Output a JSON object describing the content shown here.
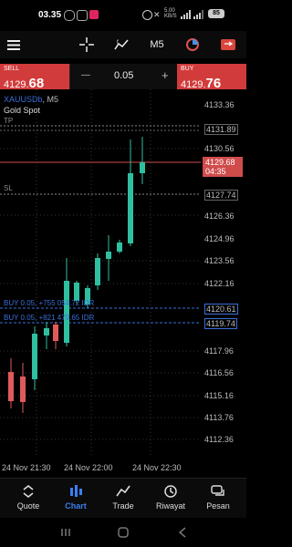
{
  "status": {
    "time": "03.35",
    "speed": "5.00\nKB/S",
    "battery": "85"
  },
  "toolbar": {
    "timeframe": "M5",
    "icons": [
      "menu-icon",
      "crosshair-icon",
      "indicator-icon",
      "timeframe-label",
      "clock-icon",
      "trade-icon"
    ]
  },
  "trade": {
    "sell_label": "SELL",
    "sell_price_small": "4129.",
    "sell_price_big": "68",
    "buy_label": "BUY",
    "buy_price_small": "4129.",
    "buy_price_big": "76",
    "volume": "0.05",
    "minus": "—",
    "plus": "+"
  },
  "chart": {
    "symbol": "XAUUSDb",
    "timeframe": "M5",
    "subtitle": "Gold Spot",
    "tp_label": "TP",
    "sl_label": "SL",
    "price_labels": [
      "4133.36",
      "4131.89",
      "4130.56",
      "4129.68",
      "04:35",
      "4127.74",
      "4126.36",
      "4124.96",
      "4123.56",
      "4122.16",
      "4120.61",
      "4119.74",
      "4117.96",
      "4116.56",
      "4115.16",
      "4113.76",
      "4112.36"
    ],
    "current_price": "4129.68",
    "countdown": "04:35",
    "order1": "BUY 0.05, +755 054.72 IDR",
    "order2": "BUY 0.05, +821 479.65 IDR",
    "time_labels": [
      "24 Nov 21:30",
      "24 Nov 22:00",
      "24 Nov 22:30"
    ],
    "colors": {
      "bull": "#2fbfa0",
      "bear": "#e15a5a",
      "line_current": "#d04c4c",
      "order_line": "#3a6fd8"
    }
  },
  "nav": {
    "items": [
      {
        "label": "Quote",
        "icon": "quote-icon"
      },
      {
        "label": "Chart",
        "icon": "chart-icon"
      },
      {
        "label": "Trade",
        "icon": "trade-icon"
      },
      {
        "label": "Riwayat",
        "icon": "history-icon"
      },
      {
        "label": "Pesan",
        "icon": "message-icon"
      }
    ],
    "active": "Chart"
  }
}
